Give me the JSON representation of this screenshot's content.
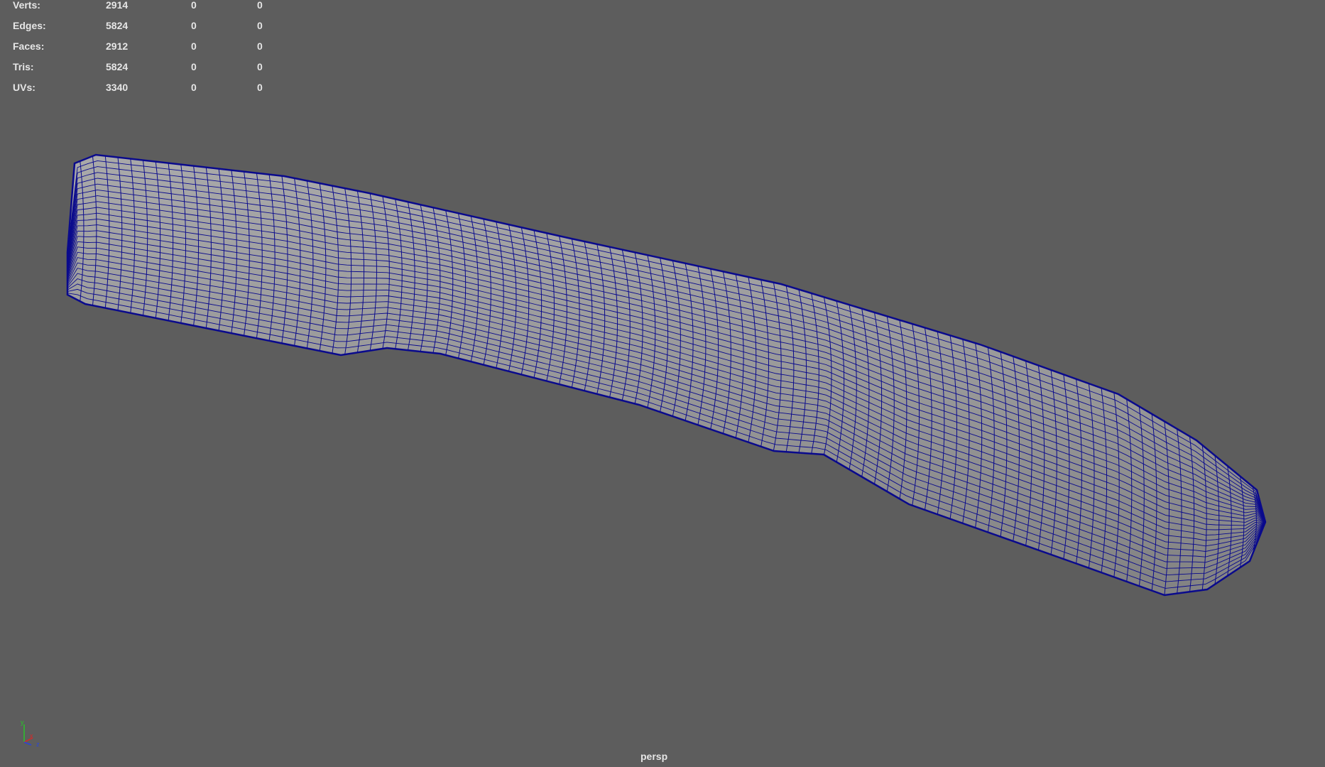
{
  "hud": {
    "rows": [
      {
        "label": "Verts:",
        "v1": "2914",
        "v2": "0",
        "v3": "0"
      },
      {
        "label": "Edges:",
        "v1": "5824",
        "v2": "0",
        "v3": "0"
      },
      {
        "label": "Faces:",
        "v1": "2912",
        "v2": "0",
        "v3": "0"
      },
      {
        "label": "Tris:",
        "v1": "5824",
        "v2": "0",
        "v3": "0"
      },
      {
        "label": "UVs:",
        "v1": "3340",
        "v2": "0",
        "v3": "0"
      }
    ]
  },
  "axis": {
    "y": "y",
    "x": "x",
    "z": "z"
  },
  "camera_label": "persp",
  "colors": {
    "background": "#5d5d5d",
    "wire": "#0a0a8c",
    "surface": "#9b9b9b",
    "hud_text": "#e6e6e6",
    "axis_y": "#29c429",
    "axis_x": "#d62828",
    "axis_z": "#2a45d8"
  }
}
